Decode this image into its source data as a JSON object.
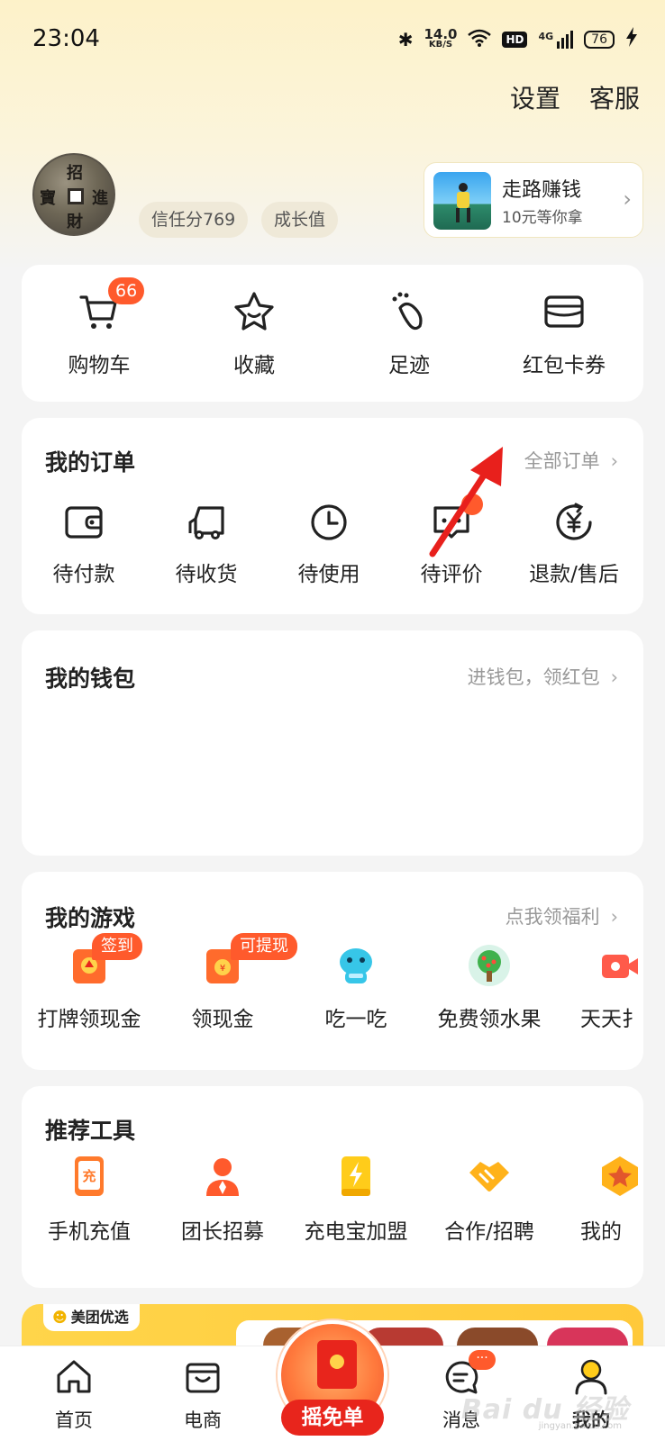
{
  "status_bar": {
    "time": "23:04",
    "net_speed": "14.0",
    "net_unit": "KB/S",
    "hd": "HD",
    "network": "4G",
    "battery": "76"
  },
  "header": {
    "settings": "设置",
    "service": "客服"
  },
  "profile": {
    "avatar_chars": [
      "招",
      "進",
      "財",
      "寶"
    ],
    "trust_score": "信任分769",
    "growth": "成长值"
  },
  "walk_card": {
    "title": "走路赚钱",
    "subtitle": "10元等你拿",
    "arrow": "›"
  },
  "quick_links": [
    {
      "label": "购物车",
      "icon": "cart-icon",
      "badge": "66"
    },
    {
      "label": "收藏",
      "icon": "star-icon"
    },
    {
      "label": "足迹",
      "icon": "footprint-icon"
    },
    {
      "label": "红包卡券",
      "icon": "coupon-card-icon"
    }
  ],
  "orders": {
    "title": "我的订单",
    "link": "全部订单",
    "chevron": "›",
    "items": [
      {
        "label": "待付款",
        "icon": "wallet-icon"
      },
      {
        "label": "待收货",
        "icon": "truck-icon"
      },
      {
        "label": "待使用",
        "icon": "clock-icon"
      },
      {
        "label": "待评价",
        "icon": "review-icon"
      },
      {
        "label": "退款/售后",
        "icon": "refund-icon"
      }
    ]
  },
  "wallet": {
    "title": "我的钱包",
    "link": "进钱包，领红包",
    "chevron": "›"
  },
  "games": {
    "title": "我的游戏",
    "link": "点我领福利",
    "chevron": "›",
    "items": [
      {
        "label": "打牌领现金",
        "icon": "card-game-icon",
        "tag": "签到"
      },
      {
        "label": "领现金",
        "icon": "cash-envelope-icon",
        "tag": "可提现"
      },
      {
        "label": "吃一吃",
        "icon": "mascot-icon"
      },
      {
        "label": "免费领水果",
        "icon": "fruit-tree-icon"
      },
      {
        "label": "天天扌",
        "icon": "video-icon"
      }
    ]
  },
  "tools": {
    "title": "推荐工具",
    "items": [
      {
        "label": "手机充值",
        "icon": "phone-recharge-icon"
      },
      {
        "label": "团长招募",
        "icon": "leader-icon"
      },
      {
        "label": "充电宝加盟",
        "icon": "power-bank-icon"
      },
      {
        "label": "合作/招聘",
        "icon": "handshake-icon"
      },
      {
        "label": "我的",
        "icon": "medal-icon"
      }
    ]
  },
  "promo": {
    "brand": "美团优选"
  },
  "bottom_nav": {
    "home": "首页",
    "shop": "电商",
    "shake": "摇免单",
    "messages": "消息",
    "messages_badge": "···",
    "mine": "我的"
  },
  "watermark": {
    "text": "Bai du 经验",
    "sub": "jingyan.baidu.com"
  },
  "colors": {
    "accent": "#ff5a2c",
    "red": "#e8251c",
    "yellow": "#ffc93a",
    "annotation": "#e8201c"
  }
}
